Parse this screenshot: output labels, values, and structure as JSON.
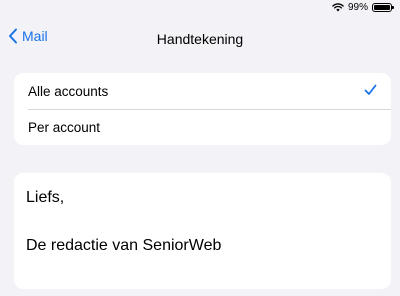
{
  "status_bar": {
    "battery_percent": "99%",
    "battery_level": 0.99,
    "icons": [
      "wifi-icon",
      "battery-icon"
    ]
  },
  "nav": {
    "back_label": "Mail",
    "back_icon": "chevron-left-icon",
    "title": "Handtekening"
  },
  "options": {
    "items": [
      {
        "label": "Alle accounts",
        "selected": true
      },
      {
        "label": "Per account",
        "selected": false
      }
    ],
    "check_icon": "checkmark-icon"
  },
  "signature": {
    "lines": [
      "Liefs,",
      "De redactie van SeniorWeb"
    ]
  },
  "colors": {
    "accent": "#1a73e8",
    "background": "#f2f2f7",
    "card": "#ffffff",
    "separator": "#d8d8dc"
  }
}
